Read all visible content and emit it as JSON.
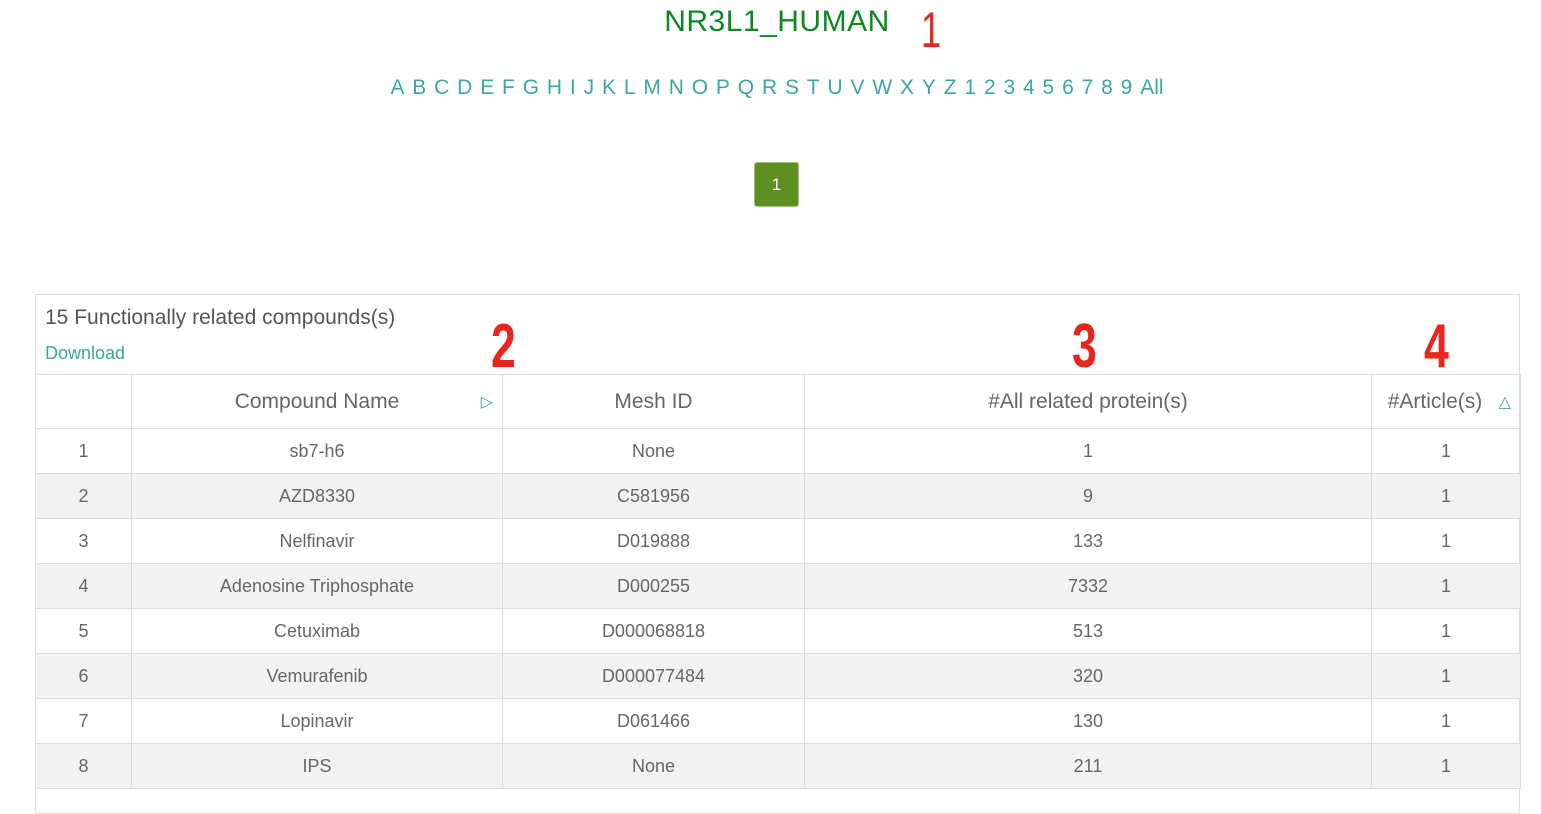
{
  "page_title": "NR3L1_HUMAN",
  "annotations": [
    "1",
    "2",
    "3",
    "4"
  ],
  "alphabet_filter": [
    "A",
    "B",
    "C",
    "D",
    "E",
    "F",
    "G",
    "H",
    "I",
    "J",
    "K",
    "L",
    "M",
    "N",
    "O",
    "P",
    "Q",
    "R",
    "S",
    "T",
    "U",
    "V",
    "W",
    "X",
    "Y",
    "Z",
    "1",
    "2",
    "3",
    "4",
    "5",
    "6",
    "7",
    "8",
    "9",
    "All"
  ],
  "pagination": {
    "current_page": "1"
  },
  "panel": {
    "heading": "15 Functionally related compounds(s)",
    "download_label": "Download"
  },
  "table": {
    "columns": [
      "",
      "Compound Name",
      "Mesh ID",
      "#All related protein(s)",
      "#Article(s)"
    ],
    "sort_icons": {
      "compound_name": "triangle-right-icon",
      "articles": "triangle-up-icon"
    },
    "rows": [
      {
        "index": "1",
        "compound": "sb7-h6",
        "mesh_id": "None",
        "proteins": "1",
        "articles": "1"
      },
      {
        "index": "2",
        "compound": "AZD8330",
        "mesh_id": "C581956",
        "proteins": "9",
        "articles": "1"
      },
      {
        "index": "3",
        "compound": "Nelfinavir",
        "mesh_id": "D019888",
        "proteins": "133",
        "articles": "1"
      },
      {
        "index": "4",
        "compound": "Adenosine Triphosphate",
        "mesh_id": "D000255",
        "proteins": "7332",
        "articles": "1"
      },
      {
        "index": "5",
        "compound": "Cetuximab",
        "mesh_id": "D000068818",
        "proteins": "513",
        "articles": "1"
      },
      {
        "index": "6",
        "compound": "Vemurafenib",
        "mesh_id": "D000077484",
        "proteins": "320",
        "articles": "1"
      },
      {
        "index": "7",
        "compound": "Lopinavir",
        "mesh_id": "D061466",
        "proteins": "130",
        "articles": "1"
      },
      {
        "index": "8",
        "compound": "IPS",
        "mesh_id": "None",
        "proteins": "211",
        "articles": "1"
      }
    ]
  },
  "colors": {
    "title": "#0c8a1f",
    "link": "#3aa89c",
    "pager_active": "#5d8f22",
    "annotation": "#e8261d",
    "row_stripe": "#f2f2f2"
  }
}
